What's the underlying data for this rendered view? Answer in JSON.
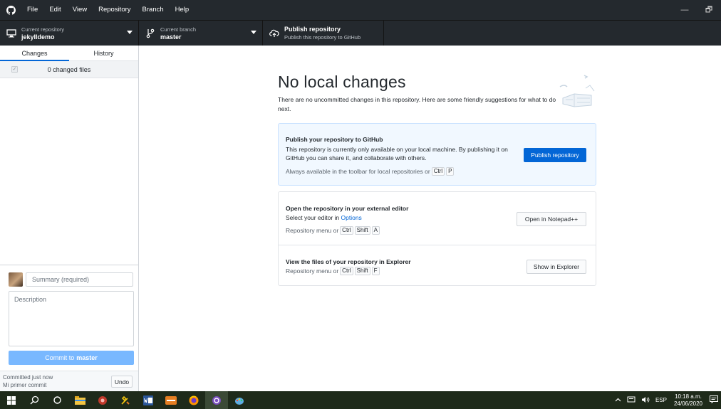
{
  "menubar": {
    "items": [
      "File",
      "Edit",
      "View",
      "Repository",
      "Branch",
      "Help"
    ],
    "minimize": "—",
    "restore": "🗗"
  },
  "toolbar": {
    "repo": {
      "caption": "Current repository",
      "value": "jekylldemo"
    },
    "branch": {
      "caption": "Current branch",
      "value": "master"
    },
    "publish": {
      "title": "Publish repository",
      "subtitle": "Publish this repository to GitHub"
    }
  },
  "sidebar": {
    "tabs": [
      "Changes",
      "History"
    ],
    "active_tab": "Changes",
    "changed_files": "0 changed files",
    "summary_placeholder": "Summary (required)",
    "description_placeholder": "Description",
    "commit_prefix": "Commit to",
    "commit_branch": "master",
    "last_commit_time": "Committed just now",
    "last_commit_message": "Mi primer commit",
    "undo_label": "Undo"
  },
  "main": {
    "title": "No local changes",
    "description": "There are no uncommitted changes in this repository. Here are some friendly suggestions for what to do next.",
    "publish_card": {
      "title": "Publish your repository to GitHub",
      "description": "This repository is currently only available on your local machine. By publishing it on GitHub you can share it, and collaborate with others.",
      "hint": "Always available in the toolbar for local repositories or",
      "keys": [
        "Ctrl",
        "P"
      ],
      "button": "Publish repository"
    },
    "editor_card": {
      "title": "Open the repository in your external editor",
      "desc_prefix": "Select your editor in",
      "desc_link": "Options",
      "hint": "Repository menu or",
      "keys": [
        "Ctrl",
        "Shift",
        "A"
      ],
      "button": "Open in Notepad++"
    },
    "explorer_card": {
      "title": "View the files of your repository in Explorer",
      "hint": "Repository menu or",
      "keys": [
        "Ctrl",
        "Shift",
        "F"
      ],
      "button": "Show in Explorer"
    }
  },
  "taskbar": {
    "language": "ESP",
    "time": "10:18 a.m.",
    "date": "24/06/2020"
  }
}
